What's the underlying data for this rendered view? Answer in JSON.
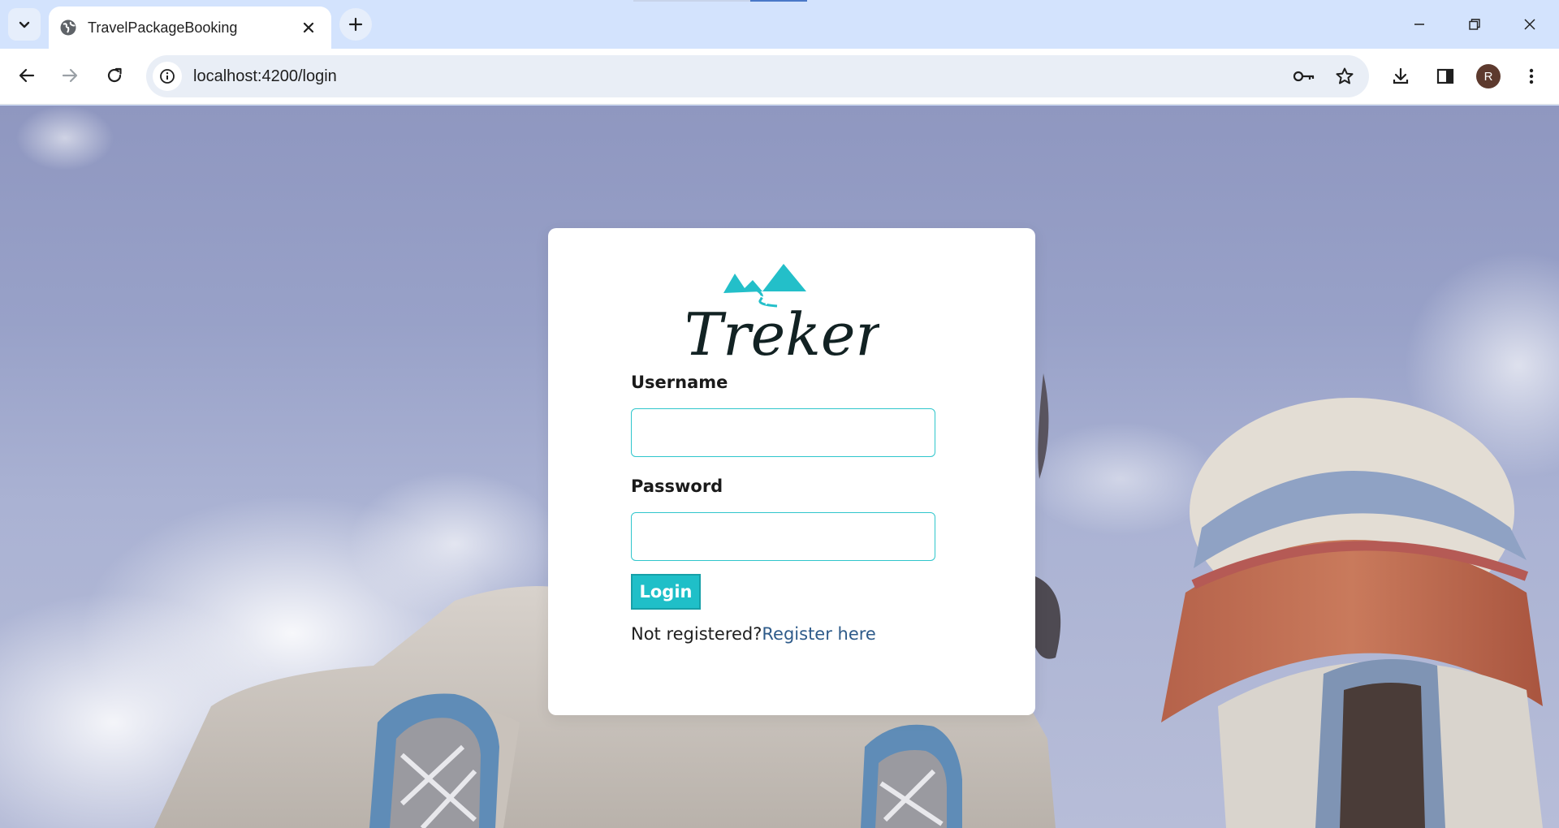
{
  "browser": {
    "tab_title": "TravelPackageBooking",
    "url": "localhost:4200/login",
    "profile_initial": "R",
    "icons": [
      "tab-search-icon",
      "globe-icon",
      "close-icon",
      "plus-icon",
      "minimize-icon",
      "restore-icon",
      "close-window-icon",
      "back-arrow-icon",
      "forward-arrow-icon",
      "reload-icon",
      "site-info-icon",
      "key-icon",
      "star-icon",
      "download-icon",
      "side-panel-icon",
      "kebab-menu-icon"
    ]
  },
  "page": {
    "logo_text": "Treker",
    "username_label": "Username",
    "username_value": "",
    "password_label": "Password",
    "password_value": "",
    "login_button": "Login",
    "not_registered_text": "Not registered?",
    "register_link": "Register here"
  },
  "colors": {
    "accent": "#1fbfc8",
    "input_border": "#2fc6cc",
    "link": "#2e5b8a",
    "sky": "#98a1c8",
    "browser_frame": "#d3e3fd"
  }
}
